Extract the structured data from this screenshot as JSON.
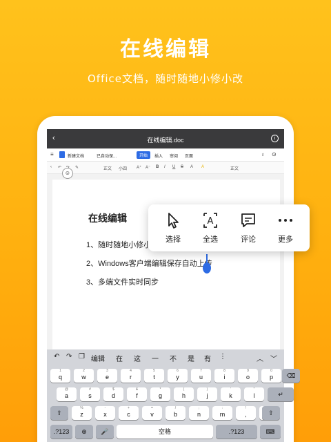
{
  "hero": {
    "title": "在线编辑",
    "subtitle": "Office文档，随时随地小修小改"
  },
  "window": {
    "back": "‹",
    "title": "在线编辑.doc",
    "info": "i"
  },
  "menubar": {
    "doc_name": "新建文档",
    "autosave": "已自动保...",
    "tabs": [
      "开始",
      "插入",
      "审阅",
      "页面"
    ]
  },
  "toolbar": {
    "font": "正文",
    "size": "小四",
    "items": [
      "A⁺",
      "A⁻",
      "B",
      "I",
      "U",
      "S",
      "A",
      "A",
      "正文"
    ]
  },
  "document": {
    "heading": "在线编辑",
    "lines": [
      "1、随时随地小修小改",
      "2、Windows客户端编辑保存自动上传",
      "3、多端文件实时同步"
    ]
  },
  "context_menu": {
    "items": [
      {
        "icon": "cursor-icon",
        "label": "选择"
      },
      {
        "icon": "select-all-icon",
        "label": "全选"
      },
      {
        "icon": "comment-icon",
        "label": "评论"
      },
      {
        "icon": "more-icon",
        "label": "更多"
      }
    ]
  },
  "keyboard": {
    "suggestions": [
      "编辑",
      "在",
      "这",
      "一",
      "不",
      "是",
      "有"
    ],
    "row1": [
      [
        "q",
        "1"
      ],
      [
        "w",
        "2"
      ],
      [
        "e",
        "3"
      ],
      [
        "r",
        "4"
      ],
      [
        "t",
        "5"
      ],
      [
        "y",
        "6"
      ],
      [
        "u",
        "7"
      ],
      [
        "i",
        "8"
      ],
      [
        "o",
        "9"
      ],
      [
        "p",
        "0"
      ]
    ],
    "row2": [
      [
        "a",
        "@"
      ],
      [
        "s",
        "#"
      ],
      [
        "d",
        "$"
      ],
      [
        "f",
        "&"
      ],
      [
        "g",
        "*"
      ],
      [
        "h",
        "("
      ],
      [
        "j",
        ")"
      ],
      [
        "k",
        "'"
      ],
      [
        "l",
        "\""
      ]
    ],
    "row3": [
      [
        "z",
        "%"
      ],
      [
        "x",
        "-"
      ],
      [
        "c",
        "+"
      ],
      [
        "v",
        "="
      ],
      [
        "b",
        "/"
      ],
      [
        "n",
        ";"
      ],
      [
        "m",
        ":"
      ],
      [
        ",",
        "!"
      ],
      [
        ".",
        "?"
      ]
    ],
    "space": "空格",
    "num_left": ".?123",
    "num_right": ".?123"
  },
  "colors": {
    "accent": "#2d6be4",
    "background": "#ffb00f"
  }
}
